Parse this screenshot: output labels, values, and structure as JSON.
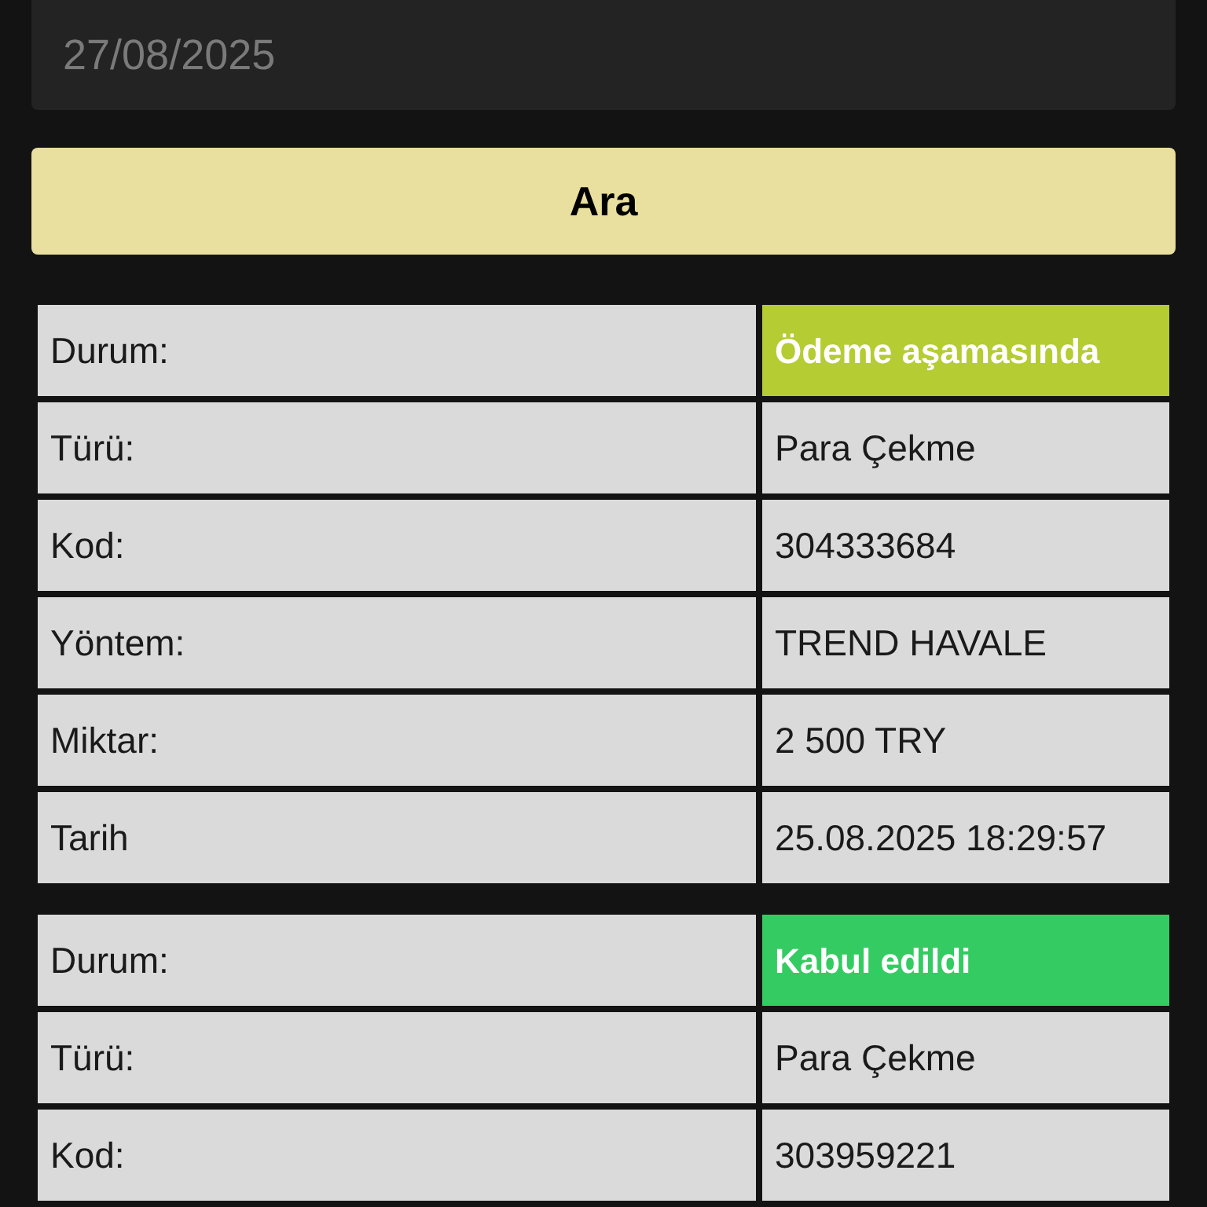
{
  "date_field": {
    "value": "27/08/2025"
  },
  "search_button": {
    "label": "Ara"
  },
  "transactions": [
    {
      "rows": [
        {
          "label": "Durum:",
          "value": "Ödeme aşamasında",
          "kind": "status",
          "color": "#b5cc33"
        },
        {
          "label": "Türü:",
          "value": "Para Çekme",
          "kind": "text"
        },
        {
          "label": "Kod:",
          "value": "304333684",
          "kind": "text"
        },
        {
          "label": "Yöntem:",
          "value": "TREND HAVALE",
          "kind": "text"
        },
        {
          "label": "Miktar:",
          "value": "2 500 TRY",
          "kind": "text"
        },
        {
          "label": "Tarih",
          "value": "25.08.2025 18:29:57",
          "kind": "text"
        }
      ]
    },
    {
      "rows": [
        {
          "label": "Durum:",
          "value": "Kabul edildi",
          "kind": "status",
          "color": "#34cc62"
        },
        {
          "label": "Türü:",
          "value": "Para Çekme",
          "kind": "text"
        },
        {
          "label": "Kod:",
          "value": "303959221",
          "kind": "text"
        }
      ]
    }
  ]
}
